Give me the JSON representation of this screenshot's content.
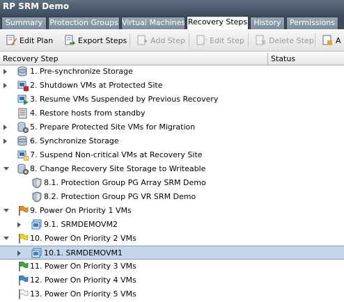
{
  "window": {
    "title": "RP SRM Demo"
  },
  "tabs": [
    {
      "label": "Summary",
      "active": false
    },
    {
      "label": "Protection Groups",
      "active": false
    },
    {
      "label": "Virtual Machines",
      "active": false
    },
    {
      "label": "Recovery Steps",
      "active": true
    },
    {
      "label": "History",
      "active": false
    },
    {
      "label": "Permissions",
      "active": false
    }
  ],
  "toolbar": {
    "edit_plan": "Edit Plan",
    "export_steps": "Export Steps",
    "add_step": "Add Step",
    "edit_step": "Edit Step",
    "delete_step": "Delete Step",
    "truncated": "A"
  },
  "columns": {
    "step": "Recovery Step",
    "status": "Status"
  },
  "steps": [
    {
      "label": "1. Pre-synchronize Storage",
      "icon": "storage-sync-icon",
      "expander": "closed"
    },
    {
      "label": "2. Shutdown VMs at Protected Site",
      "icon": "shutdown-vm-icon",
      "expander": "closed"
    },
    {
      "label": "3. Resume VMs Suspended by Previous Recovery",
      "icon": "resume-vm-icon",
      "expander": "none"
    },
    {
      "label": "4. Restore hosts from standby",
      "icon": "host-icon",
      "expander": "none"
    },
    {
      "label": "5. Prepare Protected Site VMs for Migration",
      "icon": "storage-gear-icon",
      "expander": "closed"
    },
    {
      "label": "6. Synchronize Storage",
      "icon": "storage-sync-icon",
      "expander": "closed"
    },
    {
      "label": "7. Suspend Non-critical VMs at Recovery Site",
      "icon": "suspend-vm-icon",
      "expander": "none"
    },
    {
      "label": "8. Change Recovery Site Storage to Writeable",
      "icon": "storage-gear-icon",
      "expander": "open"
    },
    {
      "label": "8.1. Protection Group PG Array SRM Demo",
      "icon": "shield-icon",
      "expander": "none"
    },
    {
      "label": "8.2. Protection Group PG VR SRM Demo",
      "icon": "shield-icon",
      "expander": "none"
    },
    {
      "label": "9. Power On Priority 1 VMs",
      "icon": "flag-orange-icon",
      "expander": "open"
    },
    {
      "label": "9.1. SRMDEMOVM2",
      "icon": "vm-icon",
      "expander": "closed"
    },
    {
      "label": "10. Power On Priority 2 VMs",
      "icon": "flag-yellow-icon",
      "expander": "open"
    },
    {
      "label": "10.1. SRMDEMOVM1",
      "icon": "vm-icon",
      "expander": "closed",
      "selected": true
    },
    {
      "label": "11. Power On Priority 3 VMs",
      "icon": "flag-green-icon",
      "expander": "none"
    },
    {
      "label": "12. Power On Priority 4 VMs",
      "icon": "flag-blue-icon",
      "expander": "none"
    },
    {
      "label": "13. Power On Priority 5 VMs",
      "icon": "flag-white-icon",
      "expander": "none"
    }
  ],
  "colors": {
    "selection": "#c6d6ea",
    "titlebar": "#3e4c5d",
    "tab_bar": "#3e4c5d"
  }
}
